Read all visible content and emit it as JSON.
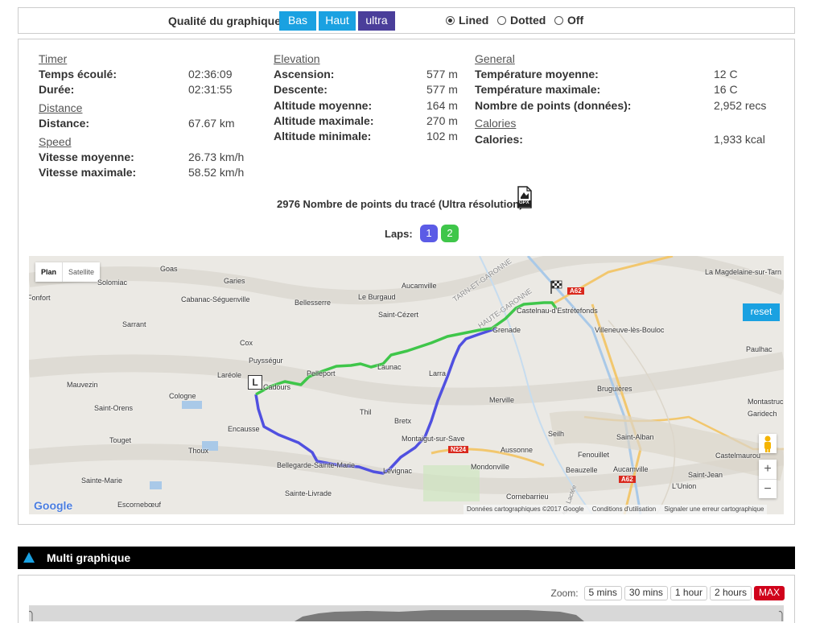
{
  "quality": {
    "label": "Qualité du graphique:",
    "buttons": [
      "Bas",
      "Haut",
      "ultra"
    ],
    "line_styles": [
      {
        "label": "Lined",
        "selected": true
      },
      {
        "label": "Dotted",
        "selected": false
      },
      {
        "label": "Off",
        "selected": false
      }
    ]
  },
  "stats": {
    "timer": {
      "title": "Timer",
      "rows": [
        {
          "label": "Temps écoulé:",
          "value": "02:36:09"
        },
        {
          "label": "Durée:",
          "value": "02:31:55"
        }
      ]
    },
    "distance": {
      "title": "Distance",
      "rows": [
        {
          "label": "Distance:",
          "value": "67.67 km"
        }
      ]
    },
    "speed": {
      "title": "Speed",
      "rows": [
        {
          "label": "Vitesse moyenne:",
          "value": "26.73 km/h"
        },
        {
          "label": "Vitesse maximale:",
          "value": "58.52 km/h"
        }
      ]
    },
    "elevation": {
      "title": "Elevation",
      "rows": [
        {
          "label": "Ascension:",
          "value": "577 m"
        },
        {
          "label": "Descente:",
          "value": "577 m"
        },
        {
          "label": "Altitude moyenne:",
          "value": "164 m"
        },
        {
          "label": "Altitude maximale:",
          "value": "270 m"
        },
        {
          "label": "Altitude minimale:",
          "value": "102 m"
        }
      ]
    },
    "general": {
      "title": "General",
      "rows": [
        {
          "label": "Température moyenne:",
          "value": "12 C"
        },
        {
          "label": "Température maximale:",
          "value": "16 C"
        },
        {
          "label": "Nombre de points (données):",
          "value": "2,952 recs"
        }
      ]
    },
    "calories": {
      "title": "Calories",
      "rows": [
        {
          "label": "Calories:",
          "value": "1,933 kcal"
        }
      ]
    }
  },
  "track_points": "2976 Nombre de points du tracé (Ultra résolution)",
  "gpx_label": "GPX",
  "laps": {
    "label": "Laps:",
    "items": [
      "1",
      "2"
    ]
  },
  "map": {
    "tabs": [
      "Plan",
      "Satellite"
    ],
    "reset": "reset",
    "zoom_in": "+",
    "zoom_out": "−",
    "start_marker": "L",
    "road_label": "A62",
    "road_label_2": "N224",
    "road_label_3": "A62",
    "attribution": "Données cartographiques ©2017 Google",
    "terms": "Conditions d'utilisation",
    "report": "Signaler une erreur cartographique",
    "google": "Google",
    "places": [
      "Goas",
      "Garies",
      "Aucamville",
      "Solomiac",
      "Cabanac-Séguenville",
      "Bellesserre",
      "Le Burgaud",
      "Saint-Cézert",
      "Sarrant",
      "Cox",
      "Puysségur",
      "Laréole",
      "Pelleport",
      "Larra",
      "Mauvezin",
      "Cologne",
      "Thil",
      "Merville",
      "Saint-Orens",
      "Bretx",
      "Encausse",
      "Touget",
      "Montaigut-sur-Save",
      "Thoux",
      "Aussonne",
      "Bellegarde-Sainte-Marie",
      "Lévignac",
      "Mondonville",
      "Sainte-Marie",
      "Sainte-Livrade",
      "Escornebœuf",
      "Cornebarrieu",
      "Castelnau-d'Estrétefonds",
      "Villeneuve-lès-Bouloc",
      "La Magdelaine-sur-Tarn",
      "Paulhac",
      "Bruguières",
      "Montastruc",
      "Garidech",
      "Seilh",
      "Saint-Alban",
      "Fenouillet",
      "Castelmaurou",
      "Beauzelle",
      "Aucamville",
      "Saint-Jean",
      "L'Union",
      "Cadours",
      "Grenade",
      "Launac",
      "TARN-ET-GARONNE",
      "HAUTE-GARONNE",
      "Voie Lactée",
      "Fonfort"
    ]
  },
  "multi": {
    "title": "Multi graphique",
    "zoom_label": "Zoom:",
    "zoom_options": [
      "5 mins",
      "30 mins",
      "1 hour",
      "2 hours",
      "MAX"
    ]
  },
  "colors": {
    "btn_blue": "#1aa1e1",
    "btn_active": "#4a3e9a",
    "lap1": "#5b5be6",
    "lap2": "#3fc64a",
    "track_green": "#3fc64a",
    "track_blue": "#5050e0",
    "max_red": "#d0021b"
  }
}
